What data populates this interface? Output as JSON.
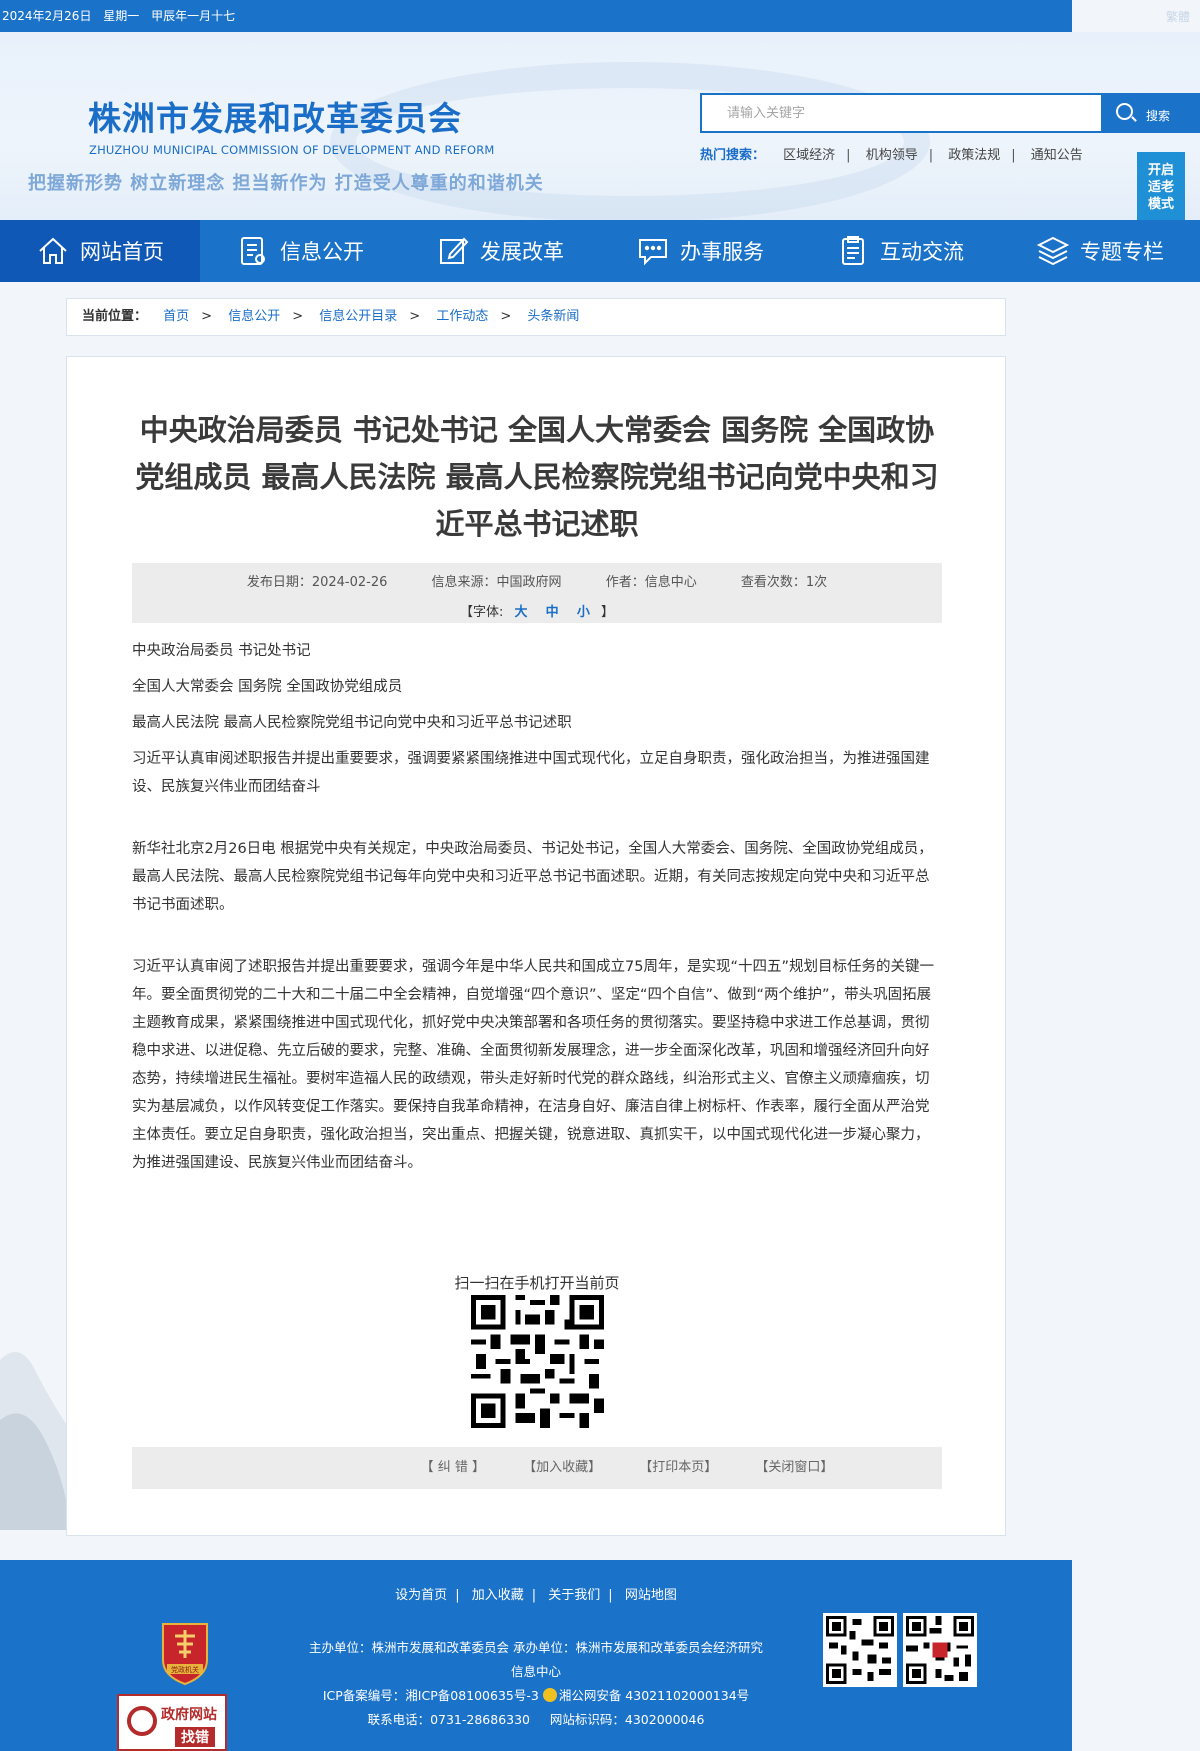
{
  "topbar": {
    "date": "2024年2月26日",
    "weekday": "星期一",
    "lunar": "甲辰年一月十七",
    "fanti": "繁體"
  },
  "header": {
    "title": "株洲市发展和改革委员会",
    "title_en": "ZHUZHOU MUNICIPAL COMMISSION OF DEVELOPMENT AND REFORM",
    "slogan": "把握新形势 树立新理念 担当新作为 打造受人尊重的和谐机关",
    "search_placeholder": "请输入关键字",
    "search_button": "搜索",
    "hot_label": "热门搜索：",
    "hot_items": [
      "区域经济",
      "机构领导",
      "政策法规",
      "通知公告"
    ],
    "elder_mode": [
      "开启",
      "适老",
      "模式"
    ]
  },
  "nav": {
    "items": [
      {
        "label": "网站首页",
        "icon": "home-icon"
      },
      {
        "label": "信息公开",
        "icon": "document-list-icon"
      },
      {
        "label": "发展改革",
        "icon": "edit-icon"
      },
      {
        "label": "办事服务",
        "icon": "chat-icon"
      },
      {
        "label": "互动交流",
        "icon": "clipboard-icon"
      },
      {
        "label": "专题专栏",
        "icon": "layers-icon"
      }
    ]
  },
  "breadcrumb": {
    "label": "当前位置：",
    "items": [
      "首页",
      "信息公开",
      "信息公开目录",
      "工作动态",
      "头条新闻"
    ]
  },
  "article": {
    "title": "中央政治局委员 书记处书记 全国人大常委会 国务院 全国政协党组成员 最高人民法院 最高人民检察院党组书记向党中央和习近平总书记述职",
    "meta": {
      "date": "发布日期：2024-02-26",
      "source": "信息来源：中国政府网",
      "author": "作者：信息中心",
      "views": "查看次数：1次",
      "font_label": "【字体:",
      "font_large": "大",
      "font_medium": "中",
      "font_small": "小",
      "font_close": "】"
    },
    "paragraphs": [
      "中央政治局委员 书记处书记",
      "全国人大常委会 国务院 全国政协党组成员",
      "最高人民法院 最高人民检察院党组书记向党中央和习近平总书记述职",
      "习近平认真审阅述职报告并提出重要要求，强调要紧紧围绕推进中国式现代化，立足自身职责，强化政治担当，为推进强国建设、民族复兴伟业而团结奋斗",
      "新华社北京2月26日电 根据党中央有关规定，中央政治局委员、书记处书记，全国人大常委会、国务院、全国政协党组成员，最高人民法院、最高人民检察院党组书记每年向党中央和习近平总书记书面述职。近期，有关同志按规定向党中央和习近平总书记书面述职。",
      "习近平认真审阅了述职报告并提出重要要求，强调今年是中华人民共和国成立75周年，是实现“十四五”规划目标任务的关键一年。要全面贯彻党的二十大和二十届二中全会精神，自觉增强“四个意识”、坚定“四个自信”、做到“两个维护”，带头巩固拓展主题教育成果，紧紧围绕推进中国式现代化，抓好党中央决策部署和各项任务的贯彻落实。要坚持稳中求进工作总基调，贯彻稳中求进、以进促稳、先立后破的要求，完整、准确、全面贯彻新发展理念，进一步全面深化改革，巩固和增强经济回升向好态势，持续增进民生福祉。要树牢造福人民的政绩观，带头走好新时代党的群众路线，纠治形式主义、官僚主义顽瘴痼疾，切实为基层减负，以作风转变促工作落实。要保持自我革命精神，在洁身自好、廉洁自律上树标杆、作表率，履行全面从严治党主体责任。要立足自身职责，强化政治担当，突出重点、把握关键，锐意进取、真抓实干，以中国式现代化进一步凝心聚力，为推进强国建设、民族复兴伟业而团结奋斗。"
    ],
    "qr_label": "扫一扫在手机打开当前页",
    "tools": [
      "【 纠 错 】",
      "【加入收藏】",
      "【打印本页】",
      "【关闭窗口】"
    ]
  },
  "footer": {
    "links": [
      "设为首页",
      "加入收藏",
      "关于我们",
      "网站地图"
    ],
    "host": "主办单位：株洲市发展和改革委员会 承办单位：株洲市发展和改革委员会经济研究信息中心",
    "icp": "ICP备案编号：湘ICP备08100635号-3",
    "police": "湘公网安备 43021102000134号",
    "phone": "联系电话：0731-28686330",
    "site_code": "网站标识码：4302000046",
    "badge_text": "党政机关",
    "zhaocuo_title": "政府网站",
    "zhaocuo_sub": "找错"
  },
  "colors": {
    "brand": "#1b72c9",
    "nav_active": "#1058b5",
    "link": "#1b6ec7"
  }
}
